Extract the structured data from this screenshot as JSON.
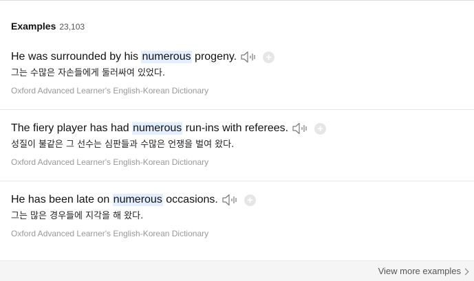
{
  "header": {
    "title": "Examples",
    "count": "23,103"
  },
  "examples": [
    {
      "before": "He was surrounded by his",
      "highlight": "numerous",
      "after": "progeny.",
      "korean": "그는 수많은 자손들에게 둘러싸여 있었다.",
      "source": "Oxford Advanced Learner's English-Korean Dictionary",
      "speaker_icon": "speaker-icon",
      "add_icon": "plus-icon"
    },
    {
      "before": "The fiery player has had",
      "highlight": "numerous",
      "after": "run-ins with referees.",
      "korean": "성질이 불같은 그 선수는 심판들과 수많은 언쟁을 벌여 왔다.",
      "source": "Oxford Advanced Learner's English-Korean Dictionary",
      "speaker_icon": "speaker-icon",
      "add_icon": "plus-icon"
    },
    {
      "before": "He has been late on",
      "highlight": "numerous",
      "after": "occasions.",
      "korean": "그는 많은 경우들에 지각을 해 왔다.",
      "source": "Oxford Advanced Learner's English-Korean Dictionary",
      "speaker_icon": "speaker-icon",
      "add_icon": "plus-icon"
    }
  ],
  "footer": {
    "view_more_label": "View more examples"
  },
  "colors": {
    "highlight_bg": "#e3efff",
    "source_text": "#999999",
    "bottom_bar_bg": "#f5f5f5"
  }
}
